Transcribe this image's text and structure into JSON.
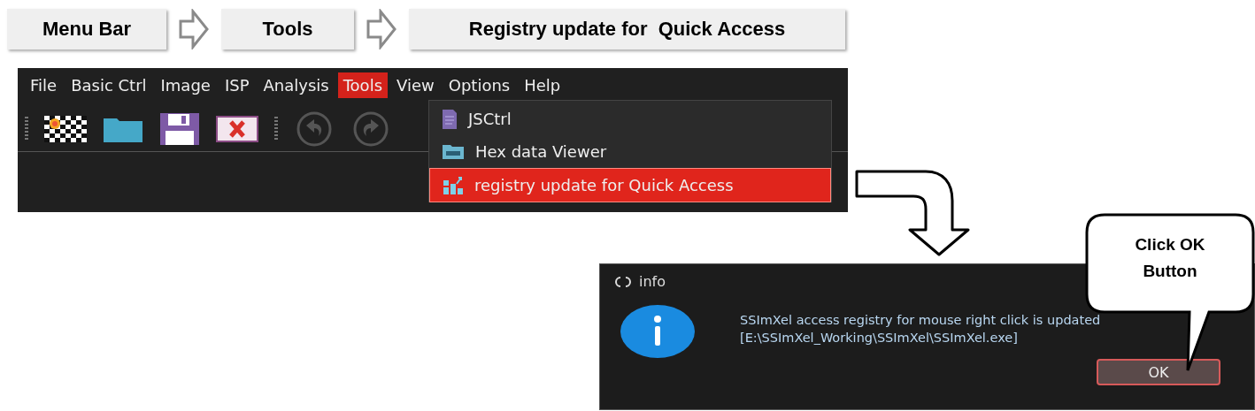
{
  "breadcrumb": [
    {
      "label": "Menu Bar"
    },
    {
      "label": "Tools"
    },
    {
      "label": "Registry update for  Quick Access"
    }
  ],
  "menu_bar": [
    {
      "label": "File",
      "selected": false
    },
    {
      "label": "Basic Ctrl",
      "selected": false
    },
    {
      "label": "Image",
      "selected": false
    },
    {
      "label": "ISP",
      "selected": false
    },
    {
      "label": "Analysis",
      "selected": false
    },
    {
      "label": "Tools",
      "selected": true
    },
    {
      "label": "View",
      "selected": false
    },
    {
      "label": "Options",
      "selected": false
    },
    {
      "label": "Help",
      "selected": false
    }
  ],
  "dropdown": [
    {
      "label": "JSCtrl",
      "kind": "script",
      "selected": false
    },
    {
      "label": "Hex data Viewer",
      "kind": "viewer",
      "selected": false
    },
    {
      "label": "registry update for Quick Access",
      "kind": "registry",
      "selected": true
    }
  ],
  "dialog": {
    "title": "info",
    "message": [
      "SSImXel access registry for mouse right click is updated",
      "[E:\\SSImXel_Working\\SSImXel\\SSImXel.exe]"
    ],
    "button": "OK"
  },
  "callout": {
    "text": "Click OK Button"
  }
}
